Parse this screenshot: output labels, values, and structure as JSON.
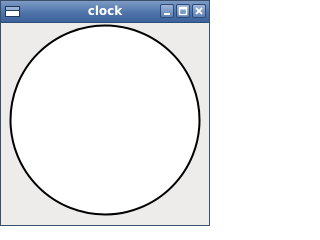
{
  "window": {
    "title": "clock",
    "icons": {
      "app": "window-icon",
      "minimize": "minimize-icon",
      "maximize": "maximize-icon",
      "close": "close-icon"
    }
  },
  "colors": {
    "titlebar": "#4f74aa",
    "window_background": "#edeceb",
    "clock_face": "#ffffff",
    "clock_outline": "#000000"
  }
}
